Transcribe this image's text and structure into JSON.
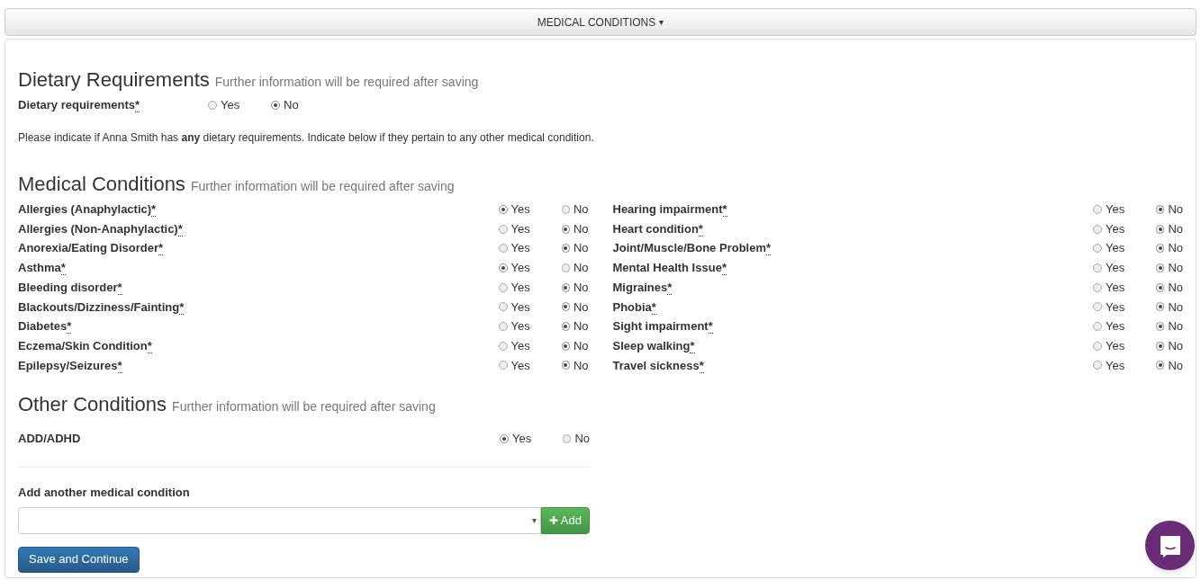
{
  "header": {
    "title": "MEDICAL CONDITIONS",
    "caret": "▾"
  },
  "dietary": {
    "heading": "Dietary Requirements",
    "subtitle": "Further information will be required after saving",
    "row": {
      "label": "Dietary requirements",
      "mark": "*",
      "options": [
        {
          "label": "Yes",
          "selected": false
        },
        {
          "label": "No",
          "selected": true
        }
      ]
    },
    "note": "Please indicate if Anna Smith has **any** dietary requirements. Indicate below if they pertain to any other medical condition."
  },
  "medical": {
    "heading": "Medical Conditions",
    "subtitle": "Further information will be required after saving",
    "columns": [
      [
        {
          "label": "Allergies (Anaphylactic)",
          "mark": "*",
          "options": [
            {
              "label": "Yes",
              "selected": true
            },
            {
              "label": "No",
              "selected": false
            }
          ]
        },
        {
          "label": "Allergies (Non-Anaphylactic)",
          "mark": "*",
          "options": [
            {
              "label": "Yes",
              "selected": false
            },
            {
              "label": "No",
              "selected": true
            }
          ]
        },
        {
          "label": "Anorexia/Eating Disorder",
          "mark": "*",
          "options": [
            {
              "label": "Yes",
              "selected": false
            },
            {
              "label": "No",
              "selected": true
            }
          ]
        },
        {
          "label": "Asthma",
          "mark": "*",
          "options": [
            {
              "label": "Yes",
              "selected": true
            },
            {
              "label": "No",
              "selected": false
            }
          ]
        },
        {
          "label": "Bleeding disorder",
          "mark": "*",
          "options": [
            {
              "label": "Yes",
              "selected": false
            },
            {
              "label": "No",
              "selected": true
            }
          ]
        },
        {
          "label": "Blackouts/Dizziness/Fainting",
          "mark": "*",
          "options": [
            {
              "label": "Yes",
              "selected": false
            },
            {
              "label": "No",
              "selected": true
            }
          ]
        },
        {
          "label": "Diabetes",
          "mark": "*",
          "options": [
            {
              "label": "Yes",
              "selected": false
            },
            {
              "label": "No",
              "selected": true
            }
          ]
        },
        {
          "label": "Eczema/Skin Condition",
          "mark": "*",
          "options": [
            {
              "label": "Yes",
              "selected": false
            },
            {
              "label": "No",
              "selected": true
            }
          ]
        },
        {
          "label": "Epilepsy/Seizures",
          "mark": "*",
          "options": [
            {
              "label": "Yes",
              "selected": false
            },
            {
              "label": "No",
              "selected": true
            }
          ]
        }
      ],
      [
        {
          "label": "Hearing impairment",
          "mark": "*",
          "options": [
            {
              "label": "Yes",
              "selected": false
            },
            {
              "label": "No",
              "selected": true
            }
          ]
        },
        {
          "label": "Heart condition",
          "mark": "*",
          "options": [
            {
              "label": "Yes",
              "selected": false
            },
            {
              "label": "No",
              "selected": true
            }
          ]
        },
        {
          "label": "Joint/Muscle/Bone Problem",
          "mark": "*",
          "options": [
            {
              "label": "Yes",
              "selected": false
            },
            {
              "label": "No",
              "selected": true
            }
          ]
        },
        {
          "label": "Mental Health Issue",
          "mark": "*",
          "options": [
            {
              "label": "Yes",
              "selected": false
            },
            {
              "label": "No",
              "selected": true
            }
          ]
        },
        {
          "label": "Migraines",
          "mark": "*",
          "options": [
            {
              "label": "Yes",
              "selected": false
            },
            {
              "label": "No",
              "selected": true
            }
          ]
        },
        {
          "label": "Phobia",
          "mark": "*",
          "options": [
            {
              "label": "Yes",
              "selected": false
            },
            {
              "label": "No",
              "selected": true
            }
          ]
        },
        {
          "label": "Sight impairment",
          "mark": "*",
          "options": [
            {
              "label": "Yes",
              "selected": false
            },
            {
              "label": "No",
              "selected": true
            }
          ]
        },
        {
          "label": "Sleep walking",
          "mark": "*",
          "options": [
            {
              "label": "Yes",
              "selected": false
            },
            {
              "label": "No",
              "selected": true
            }
          ]
        },
        {
          "label": "Travel sickness",
          "mark": "*",
          "options": [
            {
              "label": "Yes",
              "selected": false
            },
            {
              "label": "No",
              "selected": true
            }
          ]
        }
      ]
    ]
  },
  "other": {
    "heading": "Other Conditions",
    "subtitle": "Further information will be required after saving",
    "rows": [
      {
        "label": "ADD/ADHD",
        "options": [
          {
            "label": "Yes",
            "selected": true
          },
          {
            "label": "No",
            "selected": false
          }
        ]
      }
    ]
  },
  "add": {
    "label": "Add another medical condition",
    "caret": "▾",
    "button": {
      "icon": "✚",
      "label": "Add"
    }
  },
  "save_button": "Save and Continue"
}
